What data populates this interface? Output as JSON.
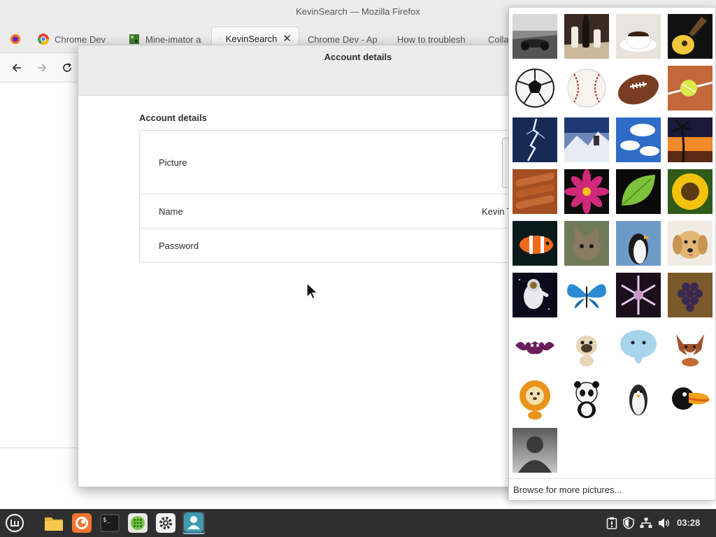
{
  "firefox": {
    "window_title": "KevinSearch — Mozilla Firefox",
    "tabs": [
      {
        "label": "Chrome Dev",
        "icon": "chrome-icon"
      },
      {
        "label": "Mine-imator a",
        "icon": "mineimator-icon"
      },
      {
        "label": "KevinSearch",
        "icon": "search-icon",
        "active": true
      },
      {
        "label": "Chrome Dev - Ap",
        "icon": "none"
      },
      {
        "label": "How to troublesh",
        "icon": "none"
      },
      {
        "label": "Colla",
        "icon": "none"
      }
    ]
  },
  "dialog": {
    "title": "Account details",
    "section_title": "Account details",
    "rows": {
      "picture": "Picture",
      "name": "Name",
      "name_value": "Kevin T",
      "password": "Password"
    }
  },
  "popover": {
    "pictures": [
      "racing-car",
      "chess-pieces",
      "coffee-cup",
      "guitar",
      "soccer-ball",
      "baseball",
      "football",
      "tennis-ball",
      "lightning",
      "mountain-climber",
      "clouds",
      "palm-sunset",
      "cinnamon",
      "pink-flower",
      "green-leaf",
      "sunflower",
      "clownfish",
      "kitten",
      "penguin",
      "puppy",
      "astronaut",
      "butterfly",
      "snowflake",
      "grapes",
      "cartoon-bat",
      "cartoon-pug",
      "cartoon-elephant",
      "cartoon-fox",
      "cartoon-lion",
      "cartoon-panda",
      "cartoon-penguin",
      "cartoon-toucan",
      "default-silhouette"
    ],
    "browse_label": "Browse for more pictures..."
  },
  "taskbar": {
    "clock": "03:28",
    "launchers": [
      "mint-menu-icon",
      "files-icon",
      "firefox-icon",
      "terminal-icon",
      "grid-app-icon",
      "settings-icon",
      "user-accounts-icon"
    ],
    "tray": [
      "clipboard-icon",
      "shield-icon",
      "network-icon",
      "volume-icon"
    ]
  }
}
